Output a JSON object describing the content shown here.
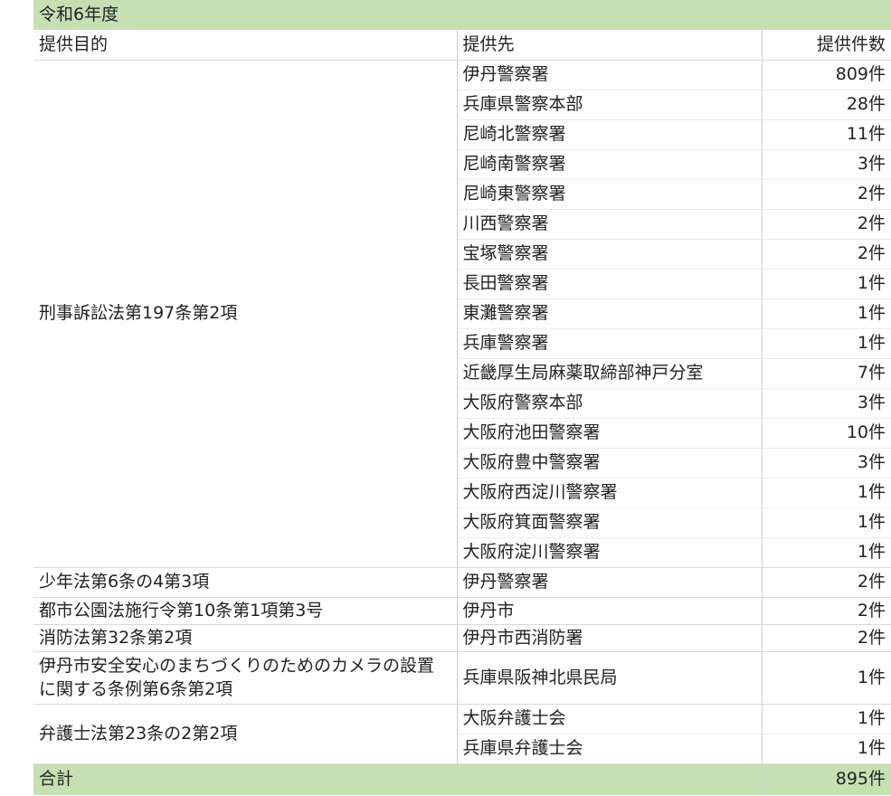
{
  "year_label": "令和6年度",
  "headers": {
    "purpose": "提供目的",
    "recipient": "提供先",
    "count": "提供件数"
  },
  "groups": [
    {
      "purpose": "刑事訴訟法第197条第2項",
      "rows": [
        {
          "recipient": "伊丹警察署",
          "count": "809件"
        },
        {
          "recipient": "兵庫県警察本部",
          "count": "28件"
        },
        {
          "recipient": "尼崎北警察署",
          "count": "11件"
        },
        {
          "recipient": "尼崎南警察署",
          "count": "3件"
        },
        {
          "recipient": "尼崎東警察署",
          "count": "2件"
        },
        {
          "recipient": "川西警察署",
          "count": "2件"
        },
        {
          "recipient": "宝塚警察署",
          "count": "2件"
        },
        {
          "recipient": "長田警察署",
          "count": "1件"
        },
        {
          "recipient": "東灘警察署",
          "count": "1件"
        },
        {
          "recipient": "兵庫警察署",
          "count": "1件"
        },
        {
          "recipient": "近畿厚生局麻薬取締部神戸分室",
          "count": "7件"
        },
        {
          "recipient": "大阪府警察本部",
          "count": "3件"
        },
        {
          "recipient": "大阪府池田警察署",
          "count": "10件"
        },
        {
          "recipient": "大阪府豊中警察署",
          "count": "3件"
        },
        {
          "recipient": "大阪府西淀川警察署",
          "count": "1件"
        },
        {
          "recipient": "大阪府箕面警察署",
          "count": "1件"
        },
        {
          "recipient": "大阪府淀川警察署",
          "count": "1件"
        }
      ]
    },
    {
      "purpose": "少年法第6条の4第3項",
      "rows": [
        {
          "recipient": "伊丹警察署",
          "count": "2件"
        }
      ]
    },
    {
      "purpose": "都市公園法施行令第10条第1項第3号",
      "rows": [
        {
          "recipient": "伊丹市",
          "count": "2件"
        }
      ]
    },
    {
      "purpose": "消防法第32条第2項",
      "rows": [
        {
          "recipient": "伊丹市西消防署",
          "count": "2件"
        }
      ]
    },
    {
      "purpose": "伊丹市安全安心のまちづくりのためのカメラの設置に関する条例第6条第2項",
      "rows": [
        {
          "recipient": "兵庫県阪神北県民局",
          "count": "1件"
        }
      ]
    },
    {
      "purpose": "弁護士法第23条の2第2項",
      "rows": [
        {
          "recipient": "大阪弁護士会",
          "count": "1件"
        },
        {
          "recipient": "兵庫県弁護士会",
          "count": "1件"
        }
      ]
    }
  ],
  "total": {
    "label": "合計",
    "count": "895件"
  }
}
